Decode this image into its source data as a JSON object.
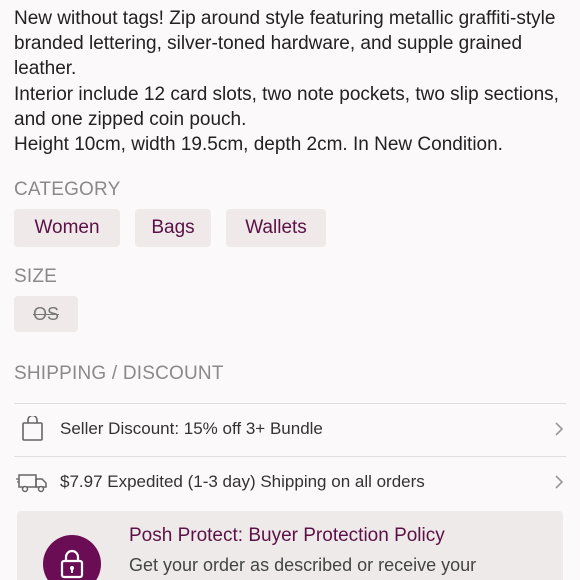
{
  "description": {
    "paragraph_1": "New without tags! Zip around style featuring metallic graffiti-style branded lettering, silver-toned hardware, and supple grained leather.",
    "paragraph_2": "Interior include 12 card slots, two note pockets, two slip sections, and one zipped coin pouch.",
    "paragraph_3": "Height 10cm, width 19.5cm, depth 2cm. In New Condition."
  },
  "category": {
    "label": "CATEGORY",
    "items": [
      "Women",
      "Bags",
      "Wallets"
    ]
  },
  "size": {
    "label": "SIZE",
    "value": "OS"
  },
  "shipping": {
    "label": "SHIPPING / DISCOUNT",
    "discount_text": "Seller Discount: 15% off 3+ Bundle",
    "shipping_text": "$7.97 Expedited (1-3 day) Shipping on all orders"
  },
  "protect": {
    "title": "Posh Protect: Buyer Protection Policy",
    "text": "Get your order as described or receive your"
  },
  "icons": {
    "discount": "shopping-bag-icon",
    "shipping": "delivery-truck-icon",
    "chevron": "chevron-right-icon",
    "protect": "padlock-icon"
  },
  "colors": {
    "accent": "#5b1146",
    "badge": "#6b0d55",
    "chip_bg": "#efe9e9",
    "label_gray": "#8a8a8a"
  }
}
